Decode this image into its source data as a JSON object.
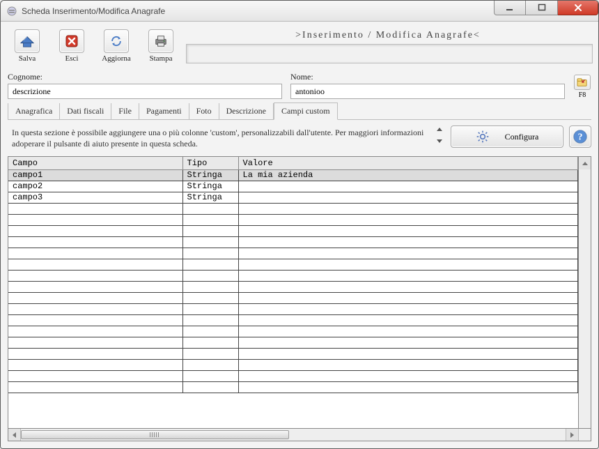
{
  "window": {
    "title": "Scheda Inserimento/Modifica Anagrafe"
  },
  "toolbar": {
    "salva": "Salva",
    "esci": "Esci",
    "aggiorna": "Aggiorna",
    "stampa": "Stampa"
  },
  "banner": ">Inserimento / Modifica Anagrafe<",
  "fields": {
    "cognome_label": "Cognome:",
    "cognome_value": "descrizione",
    "nome_label": "Nome:",
    "nome_value": "antonioo",
    "f8_label": "F8"
  },
  "tabs": {
    "anagrafica": "Anagrafica",
    "dati_fiscali": "Dati fiscali",
    "file": "File",
    "pagamenti": "Pagamenti",
    "foto": "Foto",
    "descrizione": "Descrizione",
    "campi_custom": "Campi custom"
  },
  "section_text": "In questa sezione è possibile aggiungere una o più colonne 'custom', personalizzabili dall'utente. Per maggiori informazioni adoperare il pulsante di aiuto presente in questa scheda.",
  "buttons": {
    "configura": "Configura"
  },
  "grid": {
    "columns": {
      "campo": "Campo",
      "tipo": "Tipo",
      "valore": "Valore"
    },
    "rows": [
      {
        "campo": "campo1",
        "tipo": "Stringa",
        "valore": "La mia azienda",
        "selected": true
      },
      {
        "campo": "campo2",
        "tipo": "Stringa",
        "valore": "",
        "selected": false
      },
      {
        "campo": "campo3",
        "tipo": "Stringa",
        "valore": "",
        "selected": false
      }
    ],
    "empty_rows": 17
  }
}
